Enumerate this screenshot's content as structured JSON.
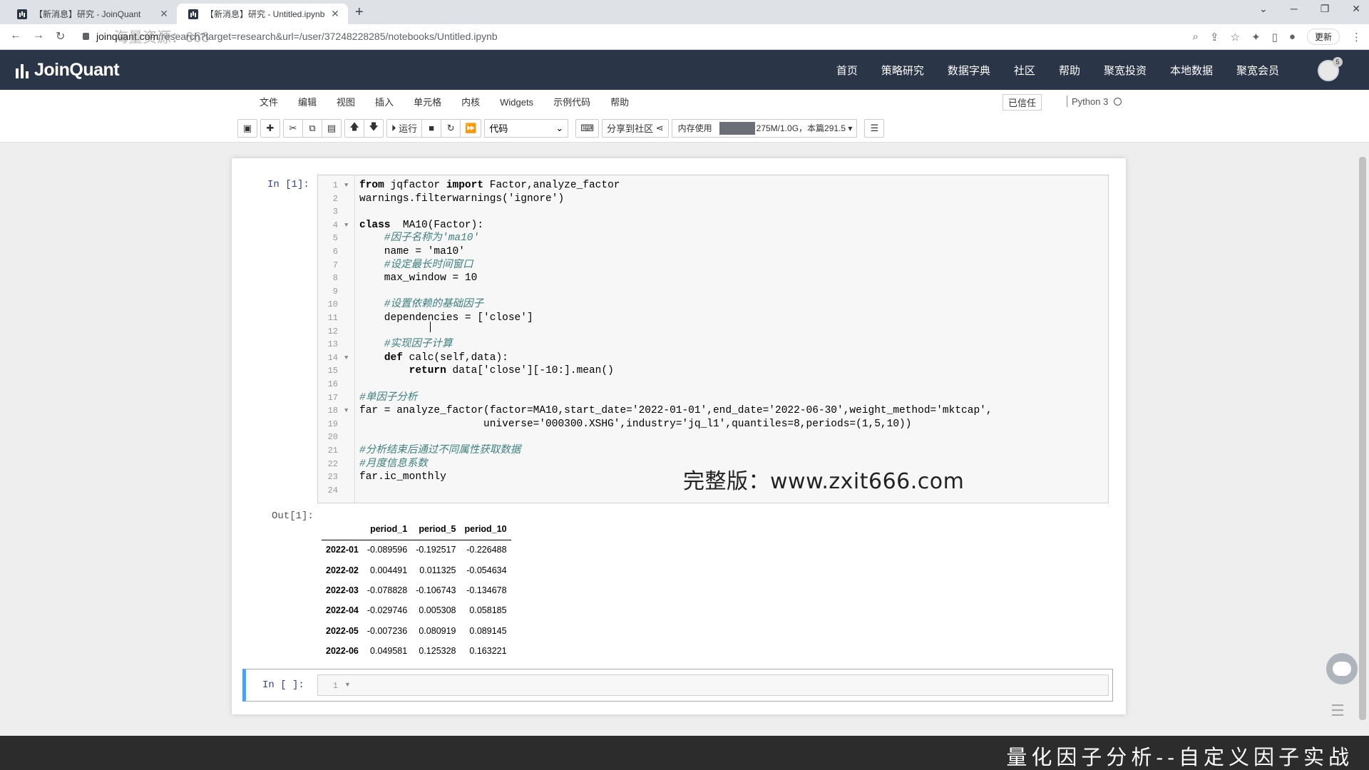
{
  "browser": {
    "tabs": [
      {
        "title": "【新消息】研究 - JoinQuant",
        "active": false
      },
      {
        "title": "【新消息】研究 - Untitled.ipynb",
        "active": true
      }
    ],
    "new_tab_label": "+",
    "url_host": "joinquant.com",
    "url_path": "/research?target=research&url=/user/37248228285/notebooks/Untitled.ipynb",
    "update_label": "更新",
    "overlay_watermark": "海量资源：666"
  },
  "site": {
    "logo_text": "JoinQuant",
    "nav": [
      "首页",
      "策略研究",
      "数据字典",
      "社区",
      "帮助",
      "聚宽投资",
      "本地数据",
      "聚宽会员"
    ],
    "avatar_badge": "5"
  },
  "notebook": {
    "menu": [
      "文件",
      "编辑",
      "视图",
      "插入",
      "单元格",
      "内核",
      "Widgets",
      "示例代码",
      "帮助"
    ],
    "trusted_label": "已信任",
    "kernel_name": "Python 3",
    "toolbar": {
      "run_label": "运行",
      "cell_type": "代码",
      "share_label": "分享到社区",
      "memory_label": "内存使用",
      "memory_value": "275M/1.0G，本篇291.5"
    },
    "cell1": {
      "in_prompt": "In  [1]:",
      "out_prompt": "Out[1]:",
      "lines": [
        "from jqfactor import Factor,analyze_factor",
        "warnings.filterwarnings('ignore')",
        "",
        "class  MA10(Factor):",
        "    #因子名称为'ma10'",
        "    name = 'ma10'",
        "    #设定最长时间窗口",
        "    max_window = 10",
        "",
        "    #设置依赖的基础因子",
        "    dependencies = ['close']",
        "",
        "    #实现因子计算",
        "    def calc(self,data):",
        "        return data['close'][-10:].mean()",
        "",
        "#单因子分析",
        "far = analyze_factor(factor=MA10,start_date='2022-01-01',end_date='2022-06-30',weight_method='mktcap',",
        "                    universe='000300.XSHG',industry='jq_l1',quantiles=8,periods=(1,5,10))",
        "",
        "#分析结束后通过不同属性获取数据",
        "#月度信息系数",
        "far.ic_monthly",
        ""
      ],
      "line_numbers": [
        "1",
        "2",
        "3",
        "4",
        "5",
        "6",
        "7",
        "8",
        "9",
        "10",
        "11",
        "12",
        "13",
        "14",
        "15",
        "16",
        "17",
        "18",
        "19",
        "20",
        "21",
        "22",
        "23",
        "24"
      ]
    },
    "output_table": {
      "columns": [
        "",
        "period_1",
        "period_5",
        "period_10"
      ],
      "rows": [
        {
          "index": "2022-01",
          "values": [
            "-0.089596",
            "-0.192517",
            "-0.226488"
          ]
        },
        {
          "index": "2022-02",
          "values": [
            "0.004491",
            "0.011325",
            "-0.054634"
          ]
        },
        {
          "index": "2022-03",
          "values": [
            "-0.078828",
            "-0.106743",
            "-0.134678"
          ]
        },
        {
          "index": "2022-04",
          "values": [
            "-0.029746",
            "0.005308",
            "0.058185"
          ]
        },
        {
          "index": "2022-05",
          "values": [
            "-0.007236",
            "0.080919",
            "0.089145"
          ]
        },
        {
          "index": "2022-06",
          "values": [
            "0.049581",
            "0.125328",
            "0.163221"
          ]
        }
      ]
    },
    "cell2": {
      "in_prompt": "In  [ ]:",
      "line_number": "1"
    }
  },
  "overlay": {
    "watermark": "完整版：www.zxit666.com",
    "caption": "量化因子分析--自定义因子实战"
  }
}
